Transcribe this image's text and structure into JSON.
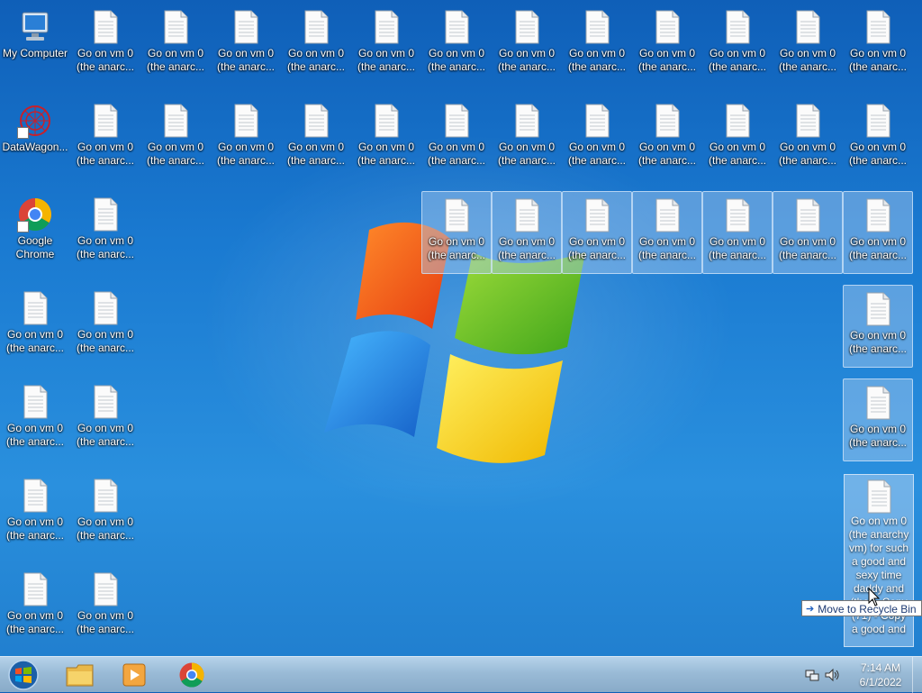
{
  "desktop": {
    "system_icons": {
      "my_computer": "My Computer",
      "datawagon": "DataWagon...",
      "chrome_line1": "Google",
      "chrome_line2": "Chrome"
    },
    "file_label_line1": "Go on vm 0",
    "file_label_line2": "(the anarc..."
  },
  "drag": {
    "ghost_text_top": "Go on vm 0",
    "ghost_text": "(the anarchy vm) for such a good and sexy time daddy and (the) - Copy (71) - Copy",
    "ghost_text_bottom": "a good and",
    "tooltip_label": "Move to Recycle Bin"
  },
  "taskbar": {
    "clock_time": "7:14 AM",
    "clock_date": "6/1/2022"
  },
  "colors": {
    "desktop_blue": "#1a7ad1",
    "selection": "#aacdf0"
  }
}
